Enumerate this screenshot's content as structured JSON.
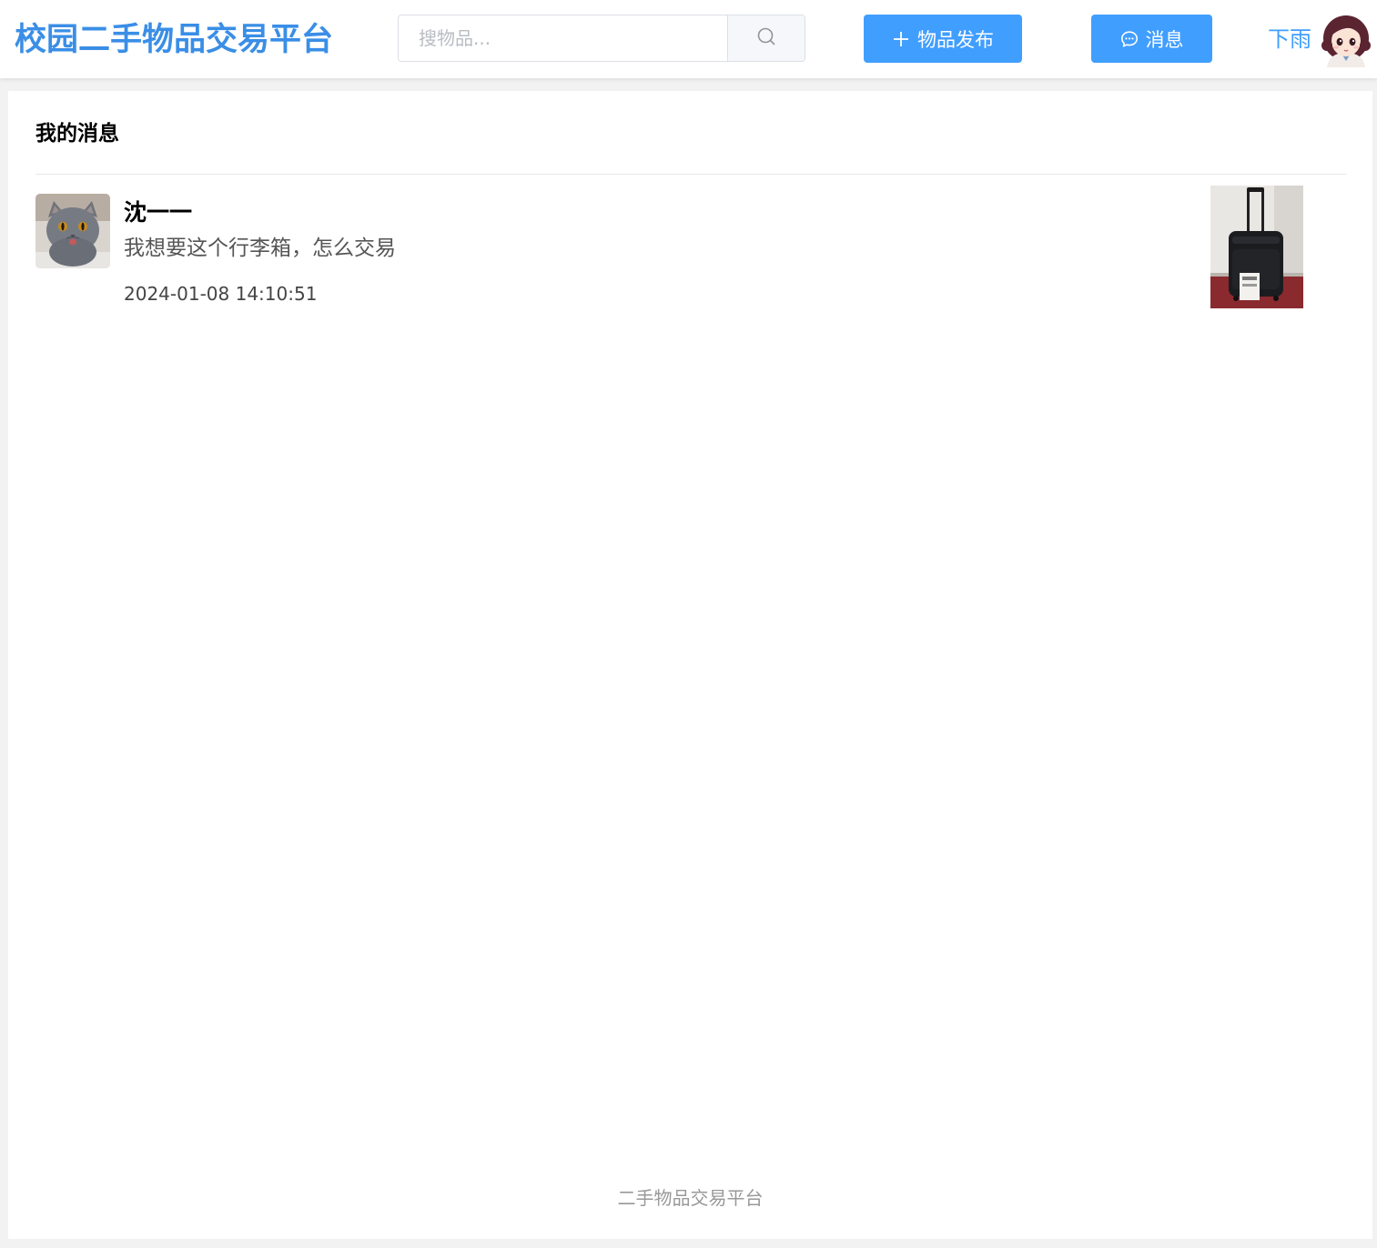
{
  "header": {
    "logo_text": "校园二手物品交易平台",
    "search": {
      "placeholder": "搜物品...",
      "value": "",
      "button_icon": "search-icon"
    },
    "publish_button": {
      "label": "物品发布",
      "icon": "plus-icon"
    },
    "messages_button": {
      "label": "消息",
      "icon": "chat-bubble-icon"
    },
    "user": {
      "name": "下雨",
      "avatar": "cartoon-girl-avatar"
    }
  },
  "main": {
    "title": "我的消息",
    "messages": [
      {
        "sender_name": "沈一一",
        "sender_avatar": "gray-cat-photo",
        "text": "我想要这个行李箱，怎么交易",
        "time": "2024-01-08 14:10:51",
        "product_image": "black-suitcase-photo"
      }
    ]
  },
  "footer": {
    "text": "二手物品交易平台"
  },
  "colors": {
    "brand": "#3a8ee6",
    "primary_button": "#409eff",
    "page_background": "#f2f2f2"
  }
}
